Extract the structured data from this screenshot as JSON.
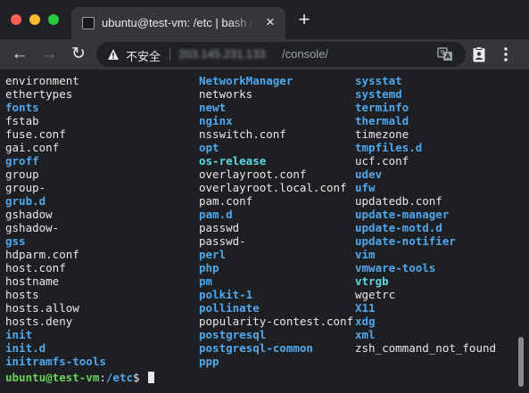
{
  "browser": {
    "tab_title": "ubuntu@test-vm: /etc | bash (t",
    "tab_close": "×",
    "new_tab": "+",
    "back": "←",
    "forward": "→",
    "reload": "↻",
    "security_label": "不安全",
    "url_host": "203.145.231.133",
    "url_path": "/console/"
  },
  "terminal": {
    "column1": [
      {
        "name": "environment",
        "kind": "plain"
      },
      {
        "name": "ethertypes",
        "kind": "plain"
      },
      {
        "name": "fonts",
        "kind": "dir"
      },
      {
        "name": "fstab",
        "kind": "plain"
      },
      {
        "name": "fuse.conf",
        "kind": "plain"
      },
      {
        "name": "gai.conf",
        "kind": "plain"
      },
      {
        "name": "groff",
        "kind": "dir"
      },
      {
        "name": "group",
        "kind": "plain"
      },
      {
        "name": "group-",
        "kind": "plain"
      },
      {
        "name": "grub.d",
        "kind": "dir"
      },
      {
        "name": "gshadow",
        "kind": "plain"
      },
      {
        "name": "gshadow-",
        "kind": "plain"
      },
      {
        "name": "gss",
        "kind": "dir"
      },
      {
        "name": "hdparm.conf",
        "kind": "plain"
      },
      {
        "name": "host.conf",
        "kind": "plain"
      },
      {
        "name": "hostname",
        "kind": "plain"
      },
      {
        "name": "hosts",
        "kind": "plain"
      },
      {
        "name": "hosts.allow",
        "kind": "plain"
      },
      {
        "name": "hosts.deny",
        "kind": "plain"
      },
      {
        "name": "init",
        "kind": "dir"
      },
      {
        "name": "init.d",
        "kind": "dir"
      },
      {
        "name": "initramfs-tools",
        "kind": "dir"
      }
    ],
    "column2": [
      {
        "name": "NetworkManager",
        "kind": "dir"
      },
      {
        "name": "networks",
        "kind": "plain"
      },
      {
        "name": "newt",
        "kind": "dir"
      },
      {
        "name": "nginx",
        "kind": "dir"
      },
      {
        "name": "nsswitch.conf",
        "kind": "plain"
      },
      {
        "name": "opt",
        "kind": "dir"
      },
      {
        "name": "os-release",
        "kind": "cyan"
      },
      {
        "name": "overlayroot.conf",
        "kind": "plain"
      },
      {
        "name": "overlayroot.local.conf",
        "kind": "plain"
      },
      {
        "name": "pam.conf",
        "kind": "plain"
      },
      {
        "name": "pam.d",
        "kind": "dir"
      },
      {
        "name": "passwd",
        "kind": "plain"
      },
      {
        "name": "passwd-",
        "kind": "plain"
      },
      {
        "name": "perl",
        "kind": "dir"
      },
      {
        "name": "php",
        "kind": "dir"
      },
      {
        "name": "pm",
        "kind": "dir"
      },
      {
        "name": "polkit-1",
        "kind": "dir"
      },
      {
        "name": "pollinate",
        "kind": "dir"
      },
      {
        "name": "popularity-contest.conf",
        "kind": "plain"
      },
      {
        "name": "postgresql",
        "kind": "dir"
      },
      {
        "name": "postgresql-common",
        "kind": "dir"
      },
      {
        "name": "ppp",
        "kind": "dir"
      }
    ],
    "column3": [
      {
        "name": "sysstat",
        "kind": "dir"
      },
      {
        "name": "systemd",
        "kind": "dir"
      },
      {
        "name": "terminfo",
        "kind": "dir"
      },
      {
        "name": "thermald",
        "kind": "dir"
      },
      {
        "name": "timezone",
        "kind": "plain"
      },
      {
        "name": "tmpfiles.d",
        "kind": "dir"
      },
      {
        "name": "ucf.conf",
        "kind": "plain"
      },
      {
        "name": "udev",
        "kind": "dir"
      },
      {
        "name": "ufw",
        "kind": "dir"
      },
      {
        "name": "updatedb.conf",
        "kind": "plain"
      },
      {
        "name": "update-manager",
        "kind": "dir"
      },
      {
        "name": "update-motd.d",
        "kind": "dir"
      },
      {
        "name": "update-notifier",
        "kind": "dir"
      },
      {
        "name": "vim",
        "kind": "dir"
      },
      {
        "name": "vmware-tools",
        "kind": "dir"
      },
      {
        "name": "vtrgb",
        "kind": "cyan"
      },
      {
        "name": "wgetrc",
        "kind": "plain"
      },
      {
        "name": "X11",
        "kind": "dir"
      },
      {
        "name": "xdg",
        "kind": "dir"
      },
      {
        "name": "xml",
        "kind": "dir"
      },
      {
        "name": "zsh_command_not_found",
        "kind": "plain"
      }
    ],
    "prompt": {
      "user_host": "ubuntu@test-vm",
      "separator": ":",
      "path": "/etc",
      "symbol": "$ "
    }
  },
  "colors": {
    "plain_text": "#e8e8e8",
    "directory": "#4fa8ee",
    "symlink": "#5fd7e0",
    "prompt_user": "#69d35a",
    "terminal_bg": "#1e1f22"
  }
}
